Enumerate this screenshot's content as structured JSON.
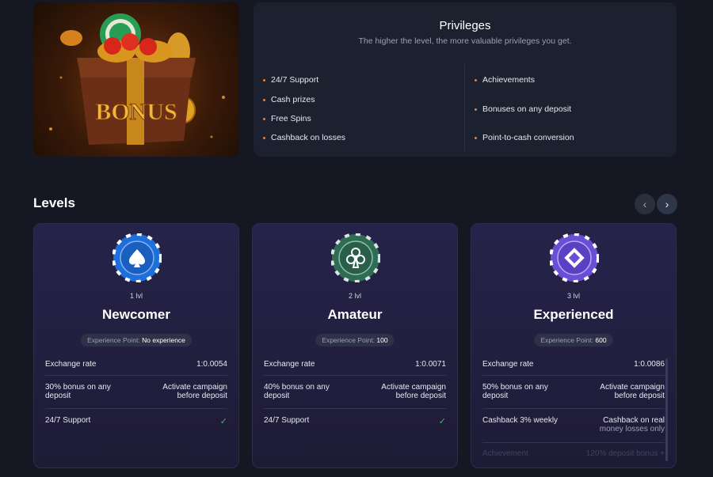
{
  "privileges": {
    "title": "Privileges",
    "subtitle": "The higher the level, the more valuable privileges you get.",
    "left_items": [
      "24/7 Support",
      "Cash prizes",
      "Free Spins",
      "Cashback on losses"
    ],
    "right_items": [
      "Achievements",
      "Bonuses on any deposit",
      "Point-to-cash conversion"
    ]
  },
  "promo": {
    "image_text": "BONUS"
  },
  "levels": {
    "title": "Levels",
    "cards": [
      {
        "icon": "spade-chip-icon",
        "chip_color": "#1e6fd9",
        "level": "1 lvl",
        "name": "Newcomer",
        "xp_label": "Experience Point:",
        "xp_value": "No experience",
        "exchange_label": "Exchange rate",
        "exchange_value": "1:0.0054",
        "bonus_label_1": "30% bonus on any",
        "bonus_label_2": "deposit",
        "bonus_value_1": "Activate campaign",
        "bonus_value_2": "before deposit",
        "support_label": "24/7 Support"
      },
      {
        "icon": "club-chip-icon",
        "chip_color": "#2f6b55",
        "level": "2 lvl",
        "name": "Amateur",
        "xp_label": "Experience Point:",
        "xp_value": "100",
        "exchange_label": "Exchange rate",
        "exchange_value": "1:0.0071",
        "bonus_label_1": "40% bonus on any",
        "bonus_label_2": "deposit",
        "bonus_value_1": "Activate campaign",
        "bonus_value_2": "before deposit",
        "support_label": "24/7 Support"
      },
      {
        "icon": "diamond-chip-icon",
        "chip_color": "#6a4fd6",
        "level": "3 lvl",
        "name": "Experienced",
        "xp_label": "Experience Point:",
        "xp_value": "600",
        "exchange_label": "Exchange rate",
        "exchange_value": "1:0.0086",
        "bonus_label_1": "50% bonus on any",
        "bonus_label_2": "deposit",
        "bonus_value_1": "Activate campaign",
        "bonus_value_2": "before deposit",
        "cashback_label": "Cashback 3% weekly",
        "cashback_value_1": "Cashback on real",
        "cashback_value_2": "money losses only",
        "achievement_label": "Achievement",
        "achievement_value": "120% deposit bonus +"
      }
    ]
  },
  "colors": {
    "accent": "#e8833a",
    "check": "#3fb96a"
  }
}
